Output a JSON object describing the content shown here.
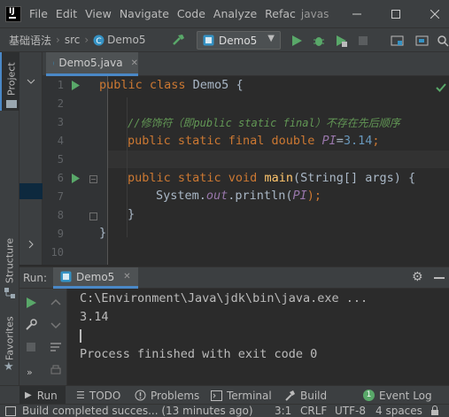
{
  "menubar": {
    "items": [
      "File",
      "Edit",
      "View",
      "Navigate",
      "Code",
      "Analyze",
      "Refac"
    ],
    "window_title": "javas"
  },
  "navbar": {
    "breadcrumb": [
      "基础语法",
      "src",
      "Demo5"
    ],
    "run_config": "Demo5"
  },
  "left_stripe": {
    "project": "Project",
    "structure": "Structure",
    "favorites": "Favorites"
  },
  "editor": {
    "tab": "Demo5.java",
    "line_numbers": [
      "1",
      "2",
      "3",
      "4",
      "5",
      "6",
      "7",
      "8",
      "9",
      "10"
    ],
    "code": {
      "l1_kw": "public class ",
      "l1_cls": "Demo5 {",
      "l3_cmt": "//修饰符（即public static final）不存在先后顺序",
      "l4_kw": "public static final double ",
      "l4_fld": "PI",
      "l4_eq": "=",
      "l4_num": "3.14",
      "l4_end": ";",
      "l6_kw": "public static void ",
      "l6_mth": "main",
      "l6_args": "(String[] args) {",
      "l7_a": "System.",
      "l7_out": "out",
      "l7_b": ".println(",
      "l7_pi": "PI",
      "l7_c": ");",
      "l8": "}",
      "l9": "}"
    }
  },
  "run_panel": {
    "label": "Run:",
    "tab": "Demo5",
    "console_lines": [
      "C:\\Environment\\Java\\jdk\\bin\\java.exe ...",
      "3.14",
      "",
      "Process finished with exit code 0"
    ]
  },
  "tool_windows": {
    "run": "Run",
    "todo": "TODO",
    "problems": "Problems",
    "terminal": "Terminal",
    "build": "Build",
    "event_log_count": "1",
    "event_log": "Event Log"
  },
  "statusbar": {
    "message": "Build completed succes... (13 minutes ago)",
    "position": "3:1",
    "line_sep": "CRLF",
    "encoding": "UTF-8",
    "indent": "4 spaces"
  },
  "colors": {
    "accent": "#4a88c7",
    "run_green": "#59a869",
    "background": "#2b2b2b",
    "panel": "#3c3f41"
  }
}
